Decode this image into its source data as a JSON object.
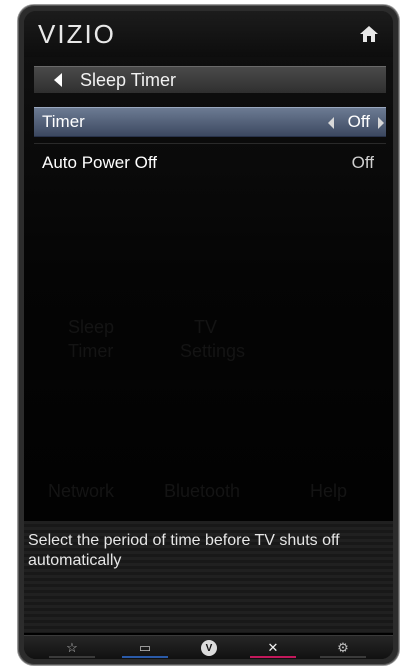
{
  "header": {
    "logo": "VIZIO",
    "home_icon": "home-icon"
  },
  "breadcrumb": {
    "title": "Sleep Timer",
    "back_icon": "triangle-left-icon"
  },
  "menu": [
    {
      "label": "Timer",
      "value": "Off",
      "selected": true
    },
    {
      "label": "Auto Power Off",
      "value": "Off",
      "selected": false
    }
  ],
  "background_menu": [
    {
      "label": "Sleep"
    },
    {
      "label": "Timer"
    },
    {
      "label": "TV"
    },
    {
      "label": "Settings"
    },
    {
      "label": "Network"
    },
    {
      "label": "Bluetooth"
    },
    {
      "label": "Help"
    }
  ],
  "help_text": "Select the period of time before TV shuts off automatically",
  "bottom_bar": [
    {
      "icon": "star-icon",
      "glyph": "☆",
      "accent": "#3a3a3a"
    },
    {
      "icon": "widget-icon",
      "glyph": "▭",
      "accent": "#2a5aa8"
    },
    {
      "icon": "vizio-v-icon",
      "glyph": "V",
      "accent": "none"
    },
    {
      "icon": "close-icon",
      "glyph": "✕",
      "accent": "#c2185b"
    },
    {
      "icon": "gear-icon",
      "glyph": "⚙",
      "accent": "#3a3a3a"
    }
  ],
  "colors": {
    "selected_row": "#5a6780",
    "background": "#000000"
  }
}
